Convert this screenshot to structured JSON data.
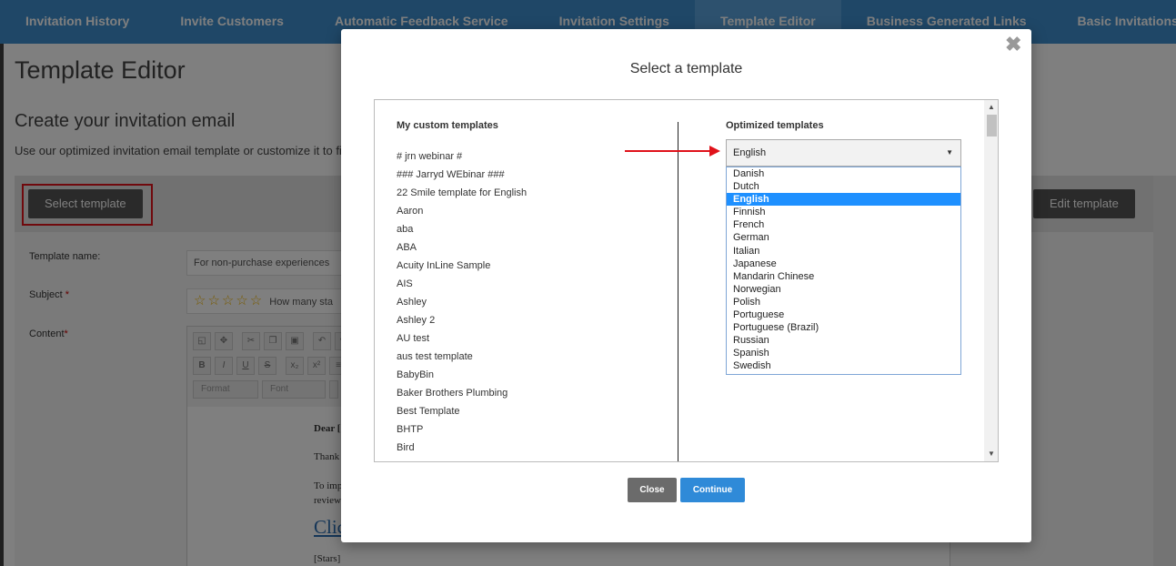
{
  "nav": {
    "tabs": [
      {
        "label": "Invitation History"
      },
      {
        "label": "Invite Customers"
      },
      {
        "label": "Automatic Feedback Service"
      },
      {
        "label": "Invitation Settings"
      },
      {
        "label": "Template Editor"
      },
      {
        "label": "Business Generated Links"
      },
      {
        "label": "Basic Invitations"
      }
    ],
    "active_tab": "Template Editor"
  },
  "page": {
    "title": "Template Editor",
    "section_title": "Create your invitation email",
    "section_desc": "Use our optimized invitation email template or customize it to fit",
    "select_template_label": "Select template",
    "edit_template_label": "Edit template"
  },
  "form": {
    "template_name_label": "Template name:",
    "template_name_value": "For non-purchase experiences",
    "subject_label": "Subject",
    "subject_required": "*",
    "subject_stars": "☆☆☆☆☆",
    "subject_value": "How many sta",
    "content_label": "Content",
    "content_required": "*",
    "editor_format_placeholder": "Format",
    "editor_font_placeholder": "Font",
    "editor_body": {
      "greeting": "Dear [",
      "thanks": "Thank",
      "improve": "To imp",
      "review": "review",
      "link_text": "Clic",
      "stars_placeholder": "[Stars]"
    }
  },
  "modal": {
    "title": "Select a template",
    "close_glyph": "✖",
    "custom_heading": "My custom templates",
    "optimized_heading": "Optimized templates",
    "custom_templates": [
      "# jrn webinar #",
      "### Jarryd WEbinar ###",
      "22 Smile template for English",
      "Aaron",
      "aba",
      "ABA",
      "Acuity InLine Sample",
      "AIS",
      "Ashley",
      "Ashley 2",
      "AU test",
      "aus test template",
      "BabyBin",
      "Baker Brothers Plumbing",
      "Best Template",
      "BHTP",
      "Bird"
    ],
    "language_selected": "English",
    "languages": [
      "Danish",
      "Dutch",
      "English",
      "Finnish",
      "French",
      "German",
      "Italian",
      "Japanese",
      "Mandarin Chinese",
      "Norwegian",
      "Polish",
      "Portuguese",
      "Portuguese (Brazil)",
      "Russian",
      "Spanish",
      "Swedish"
    ],
    "close_button_label": "Close",
    "continue_button_label": "Continue"
  },
  "colors": {
    "nav_bg": "#3f8fcf",
    "nav_active": "#5aa3dc",
    "highlight_red": "#e0121a",
    "continue_blue": "#2f8ad8",
    "list_selected": "#1e90ff"
  }
}
